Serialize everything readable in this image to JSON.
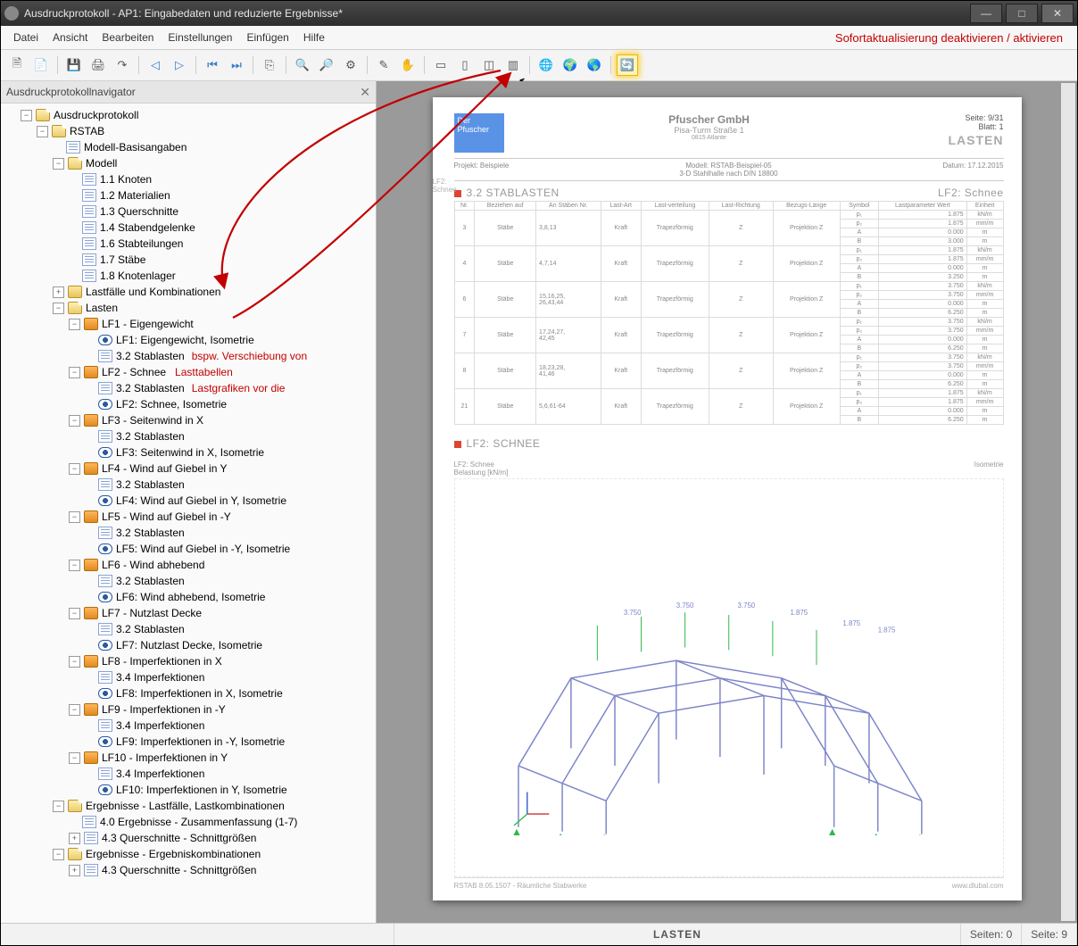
{
  "window": {
    "title": "Ausdruckprotokoll - AP1: Eingabedaten und reduzierte Ergebnisse*"
  },
  "menubar": {
    "items": [
      "Datei",
      "Ansicht",
      "Bearbeiten",
      "Einstellungen",
      "Einfügen",
      "Hilfe"
    ]
  },
  "annotations": {
    "top": "Sofortaktualisierung deaktivieren / aktivieren",
    "tree1": "bspw. Verschiebung von",
    "tree2": "Lastgrafiken vor die",
    "tree3": "Lasttabellen"
  },
  "navigator": {
    "title": "Ausdruckprotokollnavigator"
  },
  "tree": {
    "root": "Ausdruckprotokoll",
    "rstab": "RSTAB",
    "model_basis": "Modell-Basisangaben",
    "modell": "Modell",
    "modell_items": [
      "1.1 Knoten",
      "1.2 Materialien",
      "1.3 Querschnitte",
      "1.4 Stabendgelenke",
      "1.6 Stabteilungen",
      "1.7 Stäbe",
      "1.8 Knotenlager"
    ],
    "lastfaelle_komb": "Lastfälle und Kombinationen",
    "lasten": "Lasten",
    "lf": [
      {
        "t": "LF1 - Eigengewicht",
        "c": [
          "LF1: Eigengewicht, Isometrie",
          "3.2 Stablasten"
        ],
        "ci": [
          "eye",
          "page"
        ]
      },
      {
        "t": "LF2 - Schnee",
        "c": [
          "3.2 Stablasten",
          "LF2: Schnee, Isometrie"
        ],
        "ci": [
          "page",
          "eye"
        ]
      },
      {
        "t": "LF3 - Seitenwind in X",
        "c": [
          "3.2 Stablasten",
          "LF3: Seitenwind in X, Isometrie"
        ],
        "ci": [
          "page",
          "eye"
        ]
      },
      {
        "t": "LF4 - Wind auf Giebel in Y",
        "c": [
          "3.2 Stablasten",
          "LF4: Wind auf Giebel in Y, Isometrie"
        ],
        "ci": [
          "page",
          "eye"
        ]
      },
      {
        "t": "LF5 - Wind auf Giebel in -Y",
        "c": [
          "3.2 Stablasten",
          "LF5: Wind auf Giebel in -Y, Isometrie"
        ],
        "ci": [
          "page",
          "eye"
        ]
      },
      {
        "t": "LF6 - Wind abhebend",
        "c": [
          "3.2 Stablasten",
          "LF6: Wind abhebend, Isometrie"
        ],
        "ci": [
          "page",
          "eye"
        ]
      },
      {
        "t": "LF7 - Nutzlast Decke",
        "c": [
          "3.2 Stablasten",
          "LF7: Nutzlast Decke, Isometrie"
        ],
        "ci": [
          "page",
          "eye"
        ]
      },
      {
        "t": "LF8 - Imperfektionen in X",
        "c": [
          "3.4 Imperfektionen",
          "LF8: Imperfektionen in X, Isometrie"
        ],
        "ci": [
          "page",
          "eye"
        ]
      },
      {
        "t": "LF9 - Imperfektionen in -Y",
        "c": [
          "3.4 Imperfektionen",
          "LF9: Imperfektionen in -Y, Isometrie"
        ],
        "ci": [
          "page",
          "eye"
        ]
      },
      {
        "t": "LF10 - Imperfektionen in Y",
        "c": [
          "3.4 Imperfektionen",
          "LF10: Imperfektionen in Y, Isometrie"
        ],
        "ci": [
          "page",
          "eye"
        ]
      }
    ],
    "erg_lf": "Ergebnisse - Lastfälle, Lastkombinationen",
    "erg_lf_items": [
      "4.0 Ergebnisse - Zusammenfassung (1-7)",
      "4.3 Querschnitte - Schnittgrößen"
    ],
    "erg_ek": "Ergebnisse - Ergebniskombinationen",
    "erg_ek_items": [
      "4.3 Querschnitte - Schnittgrößen"
    ]
  },
  "page": {
    "logo_top": "Der",
    "logo_bot": "Pfuscher",
    "company": "Pfuscher GmbH",
    "addr1": "Pisa-Turm Straße 1",
    "addr2": "0815 Atlante",
    "hdr_right": {
      "seite": "Seite:",
      "seite_v": "9/31",
      "blatt": "Blatt:",
      "blatt_v": "1",
      "big": "LASTEN"
    },
    "meta": {
      "projekt_l": "Projekt:",
      "projekt_v": "Beispiele",
      "modell_l": "Modell:",
      "modell_v": "RSTAB-Beispiel-05",
      "sub": "3-D Stahlhalle nach DIN 18800",
      "datum_l": "Datum:",
      "datum_v": "17.12.2015"
    },
    "side_label": "LF2:\nSchnee",
    "sec1": {
      "title": "3.2 STABLASTEN",
      "right": "LF2: Schnee",
      "hdr": [
        "Nr.",
        "Beziehen auf",
        "An Stäben Nr.",
        "Last-Art",
        "Last-verteilung",
        "Last-Richtung",
        "Bezugs-Länge",
        "Symbol",
        "Lastparameter Wert",
        "Einheit"
      ]
    },
    "rows": [
      {
        "n": "3",
        "b": "Stäbe",
        "s": "3,8,13",
        "a": "Kraft",
        "v": "Trapezförmig",
        "r": "Z",
        "l": "Projektion Z",
        "p": [
          [
            "p₁",
            "1.875",
            "kN/m"
          ],
          [
            "p₂",
            "1.875",
            "mm/m"
          ],
          [
            "A",
            "0.000",
            "m"
          ],
          [
            "B",
            "3.000",
            "m"
          ]
        ]
      },
      {
        "n": "4",
        "b": "Stäbe",
        "s": "4,7,14",
        "a": "Kraft",
        "v": "Trapezförmig",
        "r": "Z",
        "l": "Projektion Z",
        "p": [
          [
            "p₁",
            "1.875",
            "kN/m"
          ],
          [
            "p₂",
            "1.875",
            "mm/m"
          ],
          [
            "A",
            "0.000",
            "m"
          ],
          [
            "B",
            "3.250",
            "m"
          ]
        ]
      },
      {
        "n": "6",
        "b": "Stäbe",
        "s": "15,16,25,\n26,43,44",
        "a": "Kraft",
        "v": "Trapezförmig",
        "r": "Z",
        "l": "Projektion Z",
        "p": [
          [
            "p₁",
            "3.750",
            "kN/m"
          ],
          [
            "p₂",
            "3.750",
            "mm/m"
          ],
          [
            "A",
            "0.000",
            "m"
          ],
          [
            "B",
            "6.250",
            "m"
          ]
        ]
      },
      {
        "n": "7",
        "b": "Stäbe",
        "s": "17,24,27,\n42,45",
        "a": "Kraft",
        "v": "Trapezförmig",
        "r": "Z",
        "l": "Projektion Z",
        "p": [
          [
            "p₁",
            "3.750",
            "kN/m"
          ],
          [
            "p₂",
            "3.750",
            "mm/m"
          ],
          [
            "A",
            "0.000",
            "m"
          ],
          [
            "B",
            "6.250",
            "m"
          ]
        ]
      },
      {
        "n": "8",
        "b": "Stäbe",
        "s": "18,23,28,\n41,46",
        "a": "Kraft",
        "v": "Trapezförmig",
        "r": "Z",
        "l": "Projektion Z",
        "p": [
          [
            "p₁",
            "3.750",
            "kN/m"
          ],
          [
            "p₂",
            "3.750",
            "mm/m"
          ],
          [
            "A",
            "0.000",
            "m"
          ],
          [
            "B",
            "6.250",
            "m"
          ]
        ]
      },
      {
        "n": "21",
        "b": "Stäbe",
        "s": "5,6,61-64",
        "a": "Kraft",
        "v": "Trapezförmig",
        "r": "Z",
        "l": "Projektion Z",
        "p": [
          [
            "p₁",
            "1.875",
            "kN/m"
          ],
          [
            "p₂",
            "1.875",
            "mm/m"
          ],
          [
            "A",
            "0.000",
            "m"
          ],
          [
            "B",
            "6.250",
            "m"
          ]
        ]
      }
    ],
    "sec2": {
      "title": "LF2: SCHNEE",
      "caption": "LF2: Schnee\nBelastung [kN/m]",
      "caption_r": "Isometrie"
    },
    "footer": {
      "left": "RSTAB 8.05.1507 - Räumliche Stabwerke",
      "right": "www.dlubal.com"
    }
  },
  "statusbar": {
    "center": "LASTEN",
    "seiten_l": "Seiten: 0",
    "seite_l": "Seite: 9"
  }
}
